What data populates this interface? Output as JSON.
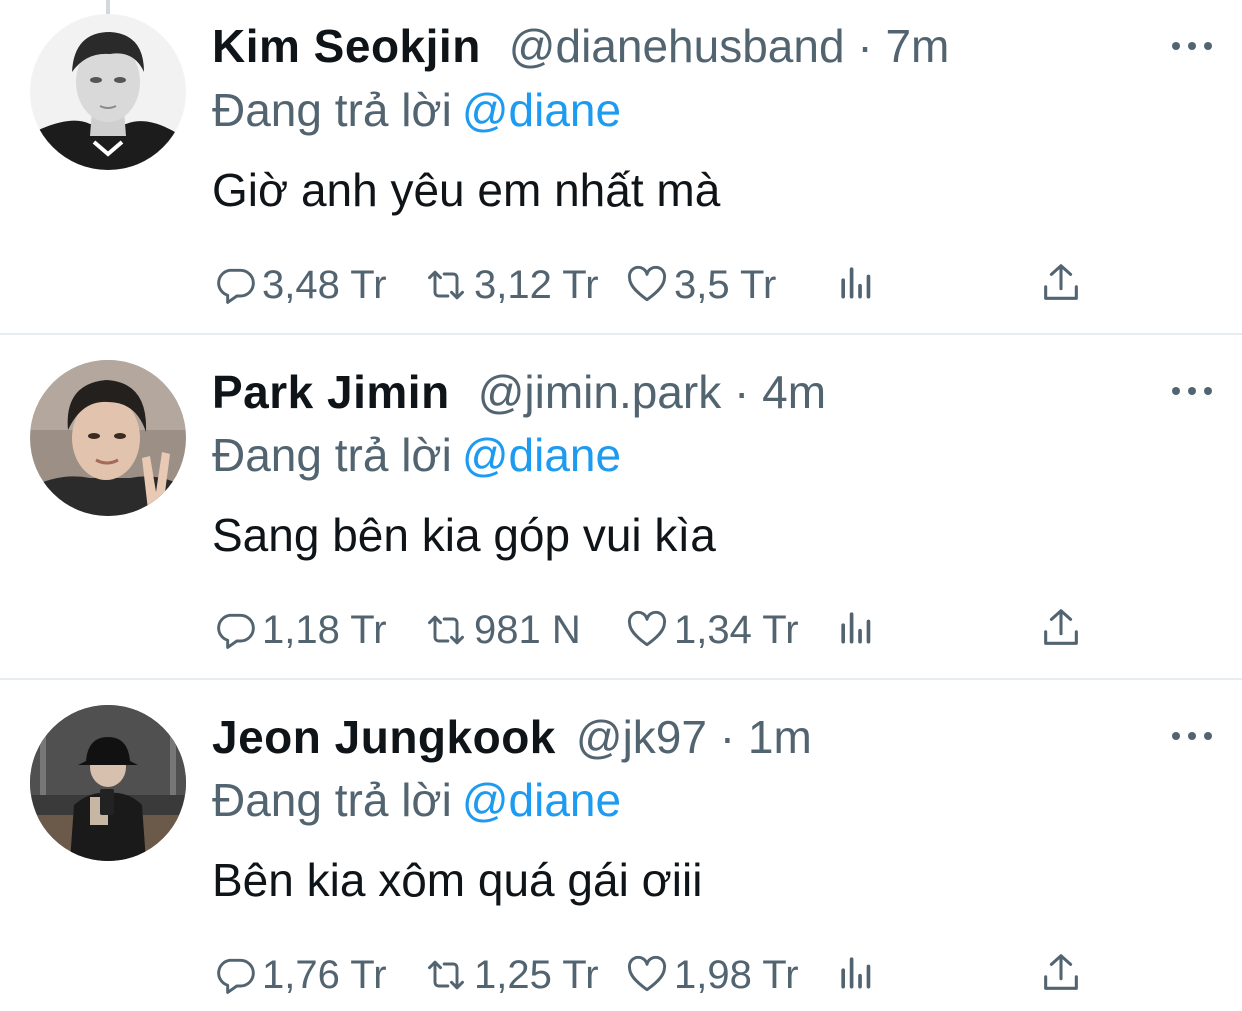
{
  "colors": {
    "accent": "#1d9bf0",
    "secondary_text": "#536471",
    "primary_text": "#0f1419",
    "divider": "#e6ecf0"
  },
  "tweets": [
    {
      "name": "Kim Seokjin",
      "handle": "@dianehusband",
      "dot": "·",
      "time": "7m",
      "reply_prefix": "Đang trả lời",
      "reply_to": "@diane",
      "text": "Giờ anh yêu em nhất mà",
      "replies": "3,48 Tr",
      "retweets": "3,12 Tr",
      "likes": "3,5 Tr",
      "avatar": "profile-photo-grayscale"
    },
    {
      "name": "Park Jimin",
      "handle": "@jimin.park",
      "dot": "·",
      "time": "4m",
      "reply_prefix": "Đang trả lời",
      "reply_to": "@diane",
      "text": "Sang bên kia góp vui kìa",
      "replies": "1,18 Tr",
      "retweets": "981 N",
      "likes": "1,34 Tr",
      "avatar": "profile-photo-peace-sign"
    },
    {
      "name": "Jeon Jungkook",
      "handle": "@jk97",
      "dot": "·",
      "time": "1m",
      "reply_prefix": "Đang trả lời",
      "reply_to": "@diane",
      "text": "Bên kia xôm quá gái ơiii",
      "replies": "1,76 Tr",
      "retweets": "1,25 Tr",
      "likes": "1,98 Tr",
      "avatar": "profile-photo-mirror-selfie"
    }
  ],
  "icons": {
    "reply": "reply-icon",
    "retweet": "retweet-icon",
    "like": "heart-icon",
    "views": "analytics-icon",
    "share": "share-icon",
    "more": "more-icon"
  }
}
